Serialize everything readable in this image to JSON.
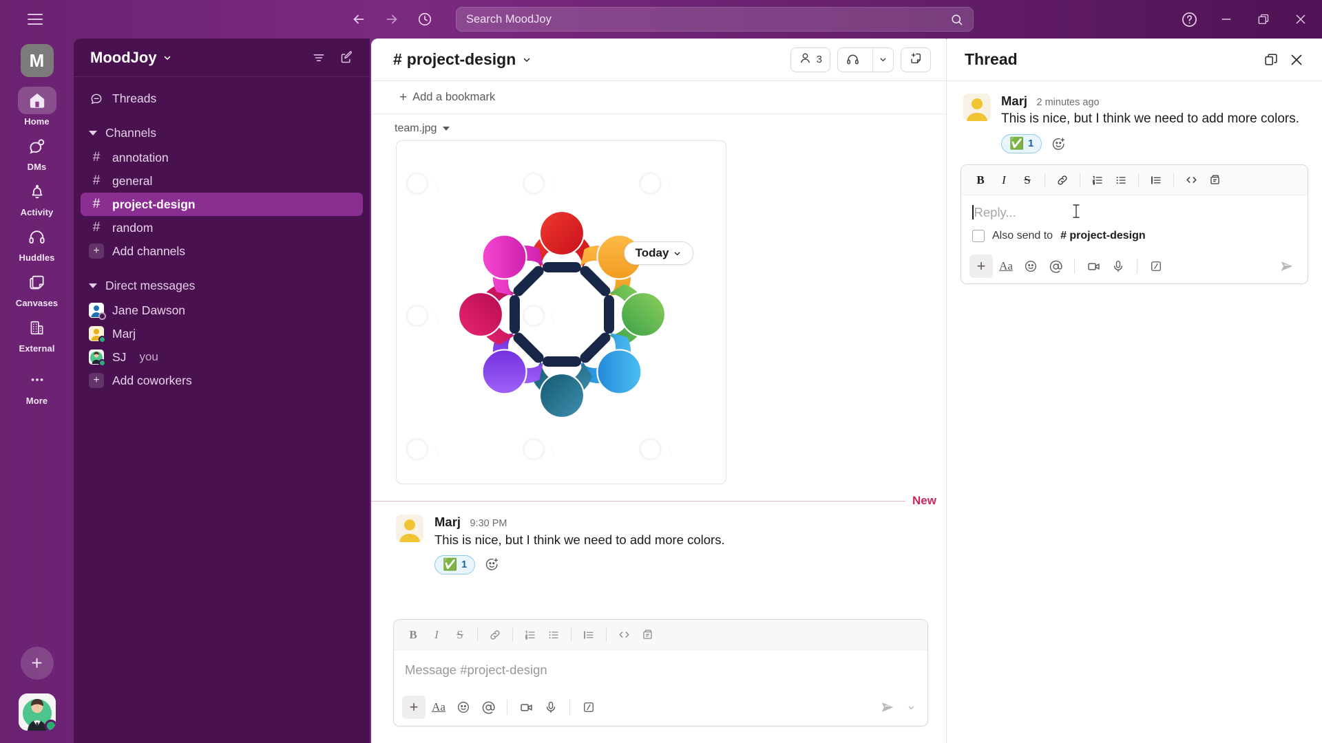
{
  "window": {
    "search_placeholder": "Search MoodJoy",
    "help_icon": "help-circle-icon",
    "minimize_icon": "minimize-icon",
    "restore_icon": "restore-icon",
    "close_icon": "close-icon",
    "back_icon": "arrow-left-icon",
    "forward_icon": "arrow-right-icon",
    "history_icon": "clock-icon",
    "menu_icon": "hamburger-icon"
  },
  "rail": {
    "workspace_initial": "M",
    "items": [
      {
        "label": "Home",
        "icon": "home-icon",
        "active": true
      },
      {
        "label": "DMs",
        "icon": "dms-icon",
        "active": false
      },
      {
        "label": "Activity",
        "icon": "bell-icon",
        "active": false
      },
      {
        "label": "Huddles",
        "icon": "headphones-icon",
        "active": false
      },
      {
        "label": "Canvases",
        "icon": "canvas-icon",
        "active": false
      },
      {
        "label": "External",
        "icon": "building-icon",
        "active": false
      },
      {
        "label": "More",
        "icon": "ellipsis-icon",
        "active": false
      }
    ],
    "new_button": "+",
    "avatar": "user-avatar"
  },
  "sidebar": {
    "workspace_name": "MoodJoy",
    "filter_icon": "filter-icon",
    "compose_icon": "compose-icon",
    "threads_label": "Threads",
    "channels_section": "Channels",
    "channels": [
      {
        "name": "annotation",
        "selected": false
      },
      {
        "name": "general",
        "selected": false
      },
      {
        "name": "project-design",
        "selected": true
      },
      {
        "name": "random",
        "selected": false
      }
    ],
    "add_channels": "Add channels",
    "dm_section": "Direct messages",
    "dms": [
      {
        "name": "Jane Dawson",
        "you": "",
        "avatar_color": "#1f6fb5",
        "avatar_bg": "#e8f0fa",
        "status": "away"
      },
      {
        "name": "Marj",
        "you": "",
        "avatar_color": "#e8b21f",
        "avatar_bg": "#fdf3d6",
        "status": "active"
      },
      {
        "name": "SJ",
        "you": "you",
        "avatar_color": "#2ea66f",
        "avatar_bg": "#dff3e6",
        "status": "active"
      }
    ],
    "add_coworkers": "Add coworkers"
  },
  "channel": {
    "hash": "#",
    "name": "project-design",
    "members_count": "3",
    "members_icon": "person-icon",
    "huddle_icon": "headphones-icon",
    "huddle_caret_icon": "chevron-down-icon",
    "canvas_icon": "add-canvas-icon",
    "bookmark_label": "Add a bookmark",
    "date_divider": "Today",
    "file_name": "team.jpg",
    "new_divider_label": "New"
  },
  "message": {
    "author": "Marj",
    "time": "9:30 PM",
    "text": "This is nice, but I think we need to add more colors.",
    "reaction_emoji": "✅",
    "reaction_count": "1",
    "add_reaction_icon": "add-reaction-icon"
  },
  "composer": {
    "placeholder": "Message #project-design",
    "format_buttons": [
      {
        "name": "bold",
        "glyph": "B"
      },
      {
        "name": "italic",
        "glyph": "I"
      },
      {
        "name": "strikethrough",
        "glyph": "S"
      },
      {
        "name": "link",
        "glyph": "link-icon"
      },
      {
        "name": "ordered-list",
        "glyph": "ordered-list-icon"
      },
      {
        "name": "bulleted-list",
        "glyph": "bulleted-list-icon"
      },
      {
        "name": "blockquote",
        "glyph": "blockquote-icon"
      },
      {
        "name": "code",
        "glyph": "code-icon"
      },
      {
        "name": "code-block",
        "glyph": "code-block-icon"
      }
    ],
    "action_buttons": [
      {
        "name": "attach",
        "glyph": "plus-icon"
      },
      {
        "name": "formatting",
        "glyph": "Aa"
      },
      {
        "name": "emoji",
        "glyph": "emoji-icon"
      },
      {
        "name": "mention",
        "glyph": "at-icon"
      },
      {
        "name": "video",
        "glyph": "video-icon"
      },
      {
        "name": "audio",
        "glyph": "microphone-icon"
      },
      {
        "name": "shortcuts",
        "glyph": "slash-icon"
      }
    ],
    "send_icon": "send-icon",
    "send_options_icon": "chevron-down-icon"
  },
  "thread": {
    "title": "Thread",
    "expand_icon": "open-in-window-icon",
    "close_icon": "close-icon",
    "message": {
      "author": "Marj",
      "time": "2 minutes ago",
      "text": "This is nice, but I think we need to add more colors.",
      "reaction_emoji": "✅",
      "reaction_count": "1",
      "add_reaction_icon": "add-reaction-icon"
    },
    "reply_placeholder": "Reply...",
    "also_send_label": "Also send to",
    "also_send_channel": "# project-design",
    "also_send_checked": false,
    "send_icon": "send-icon"
  },
  "colors": {
    "brand_purple": "#4a1150",
    "rail_purple": "#7b2a80",
    "selected_channel": "#8b2e92",
    "new_divider": "#c7295b",
    "reaction_blue": "#1264a3",
    "online_green": "#2bac76"
  },
  "image": {
    "alt": "team.jpg — circle of eight colorful figures holding hands",
    "figure_colors": [
      "#e01b24",
      "#f0a522",
      "#4caf50",
      "#29a8e0",
      "#1b6f8f",
      "#7b3fe4",
      "#d0156a",
      "#e02fc0"
    ]
  }
}
